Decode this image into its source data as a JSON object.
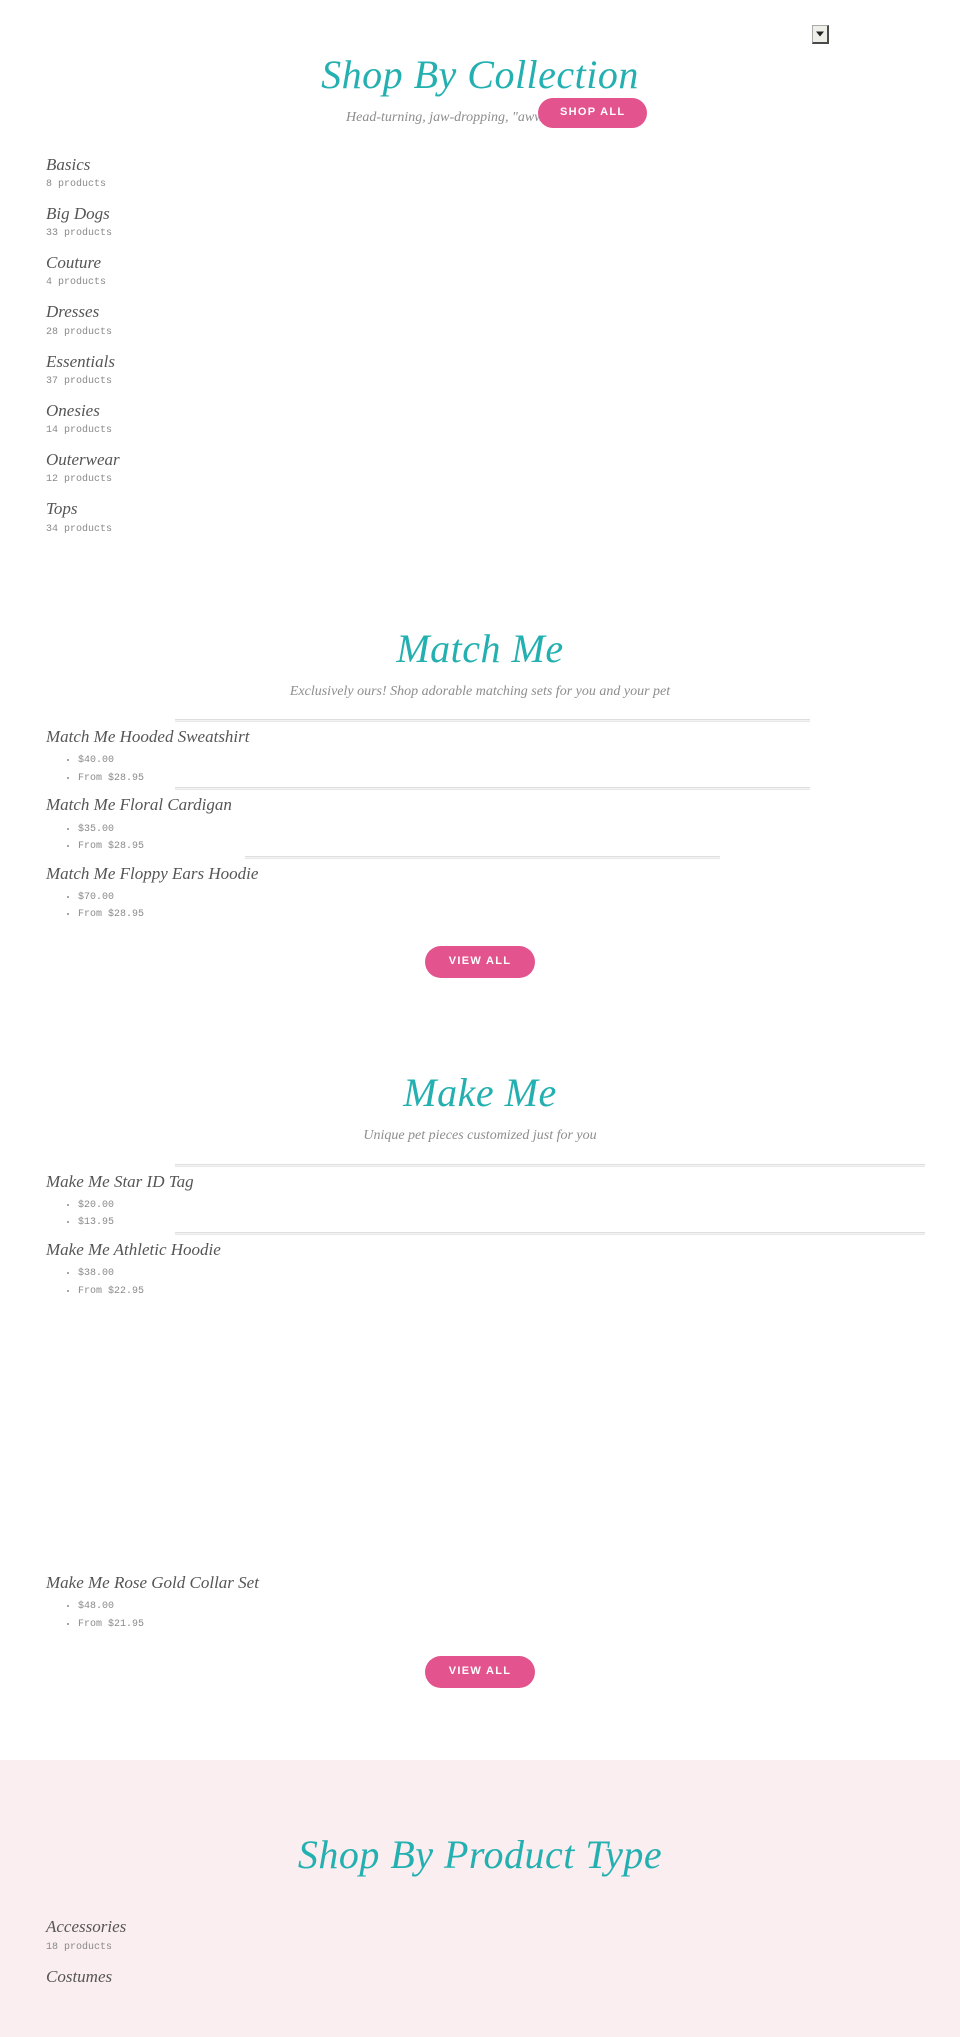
{
  "theme": {
    "accent_teal": "#24b0b0",
    "accent_pink": "#e3538e",
    "page_bg": "#ffffff",
    "section_bg_pink": "#faeef0",
    "text_gray": "#555555",
    "muted_gray": "#8a8a8a"
  },
  "top_control": {
    "name": "select-dropdown",
    "icon": "chevron-down-icon",
    "value": ""
  },
  "shop_by_collection": {
    "title": "Shop By Collection",
    "subtitle": "Head-turning, jaw-dropping, \"awww\"-inspiring",
    "button_label": "SHOP ALL",
    "collections": [
      {
        "name": "Basics",
        "count": "8 products"
      },
      {
        "name": "Big Dogs",
        "count": "33 products"
      },
      {
        "name": "Couture",
        "count": "4 products"
      },
      {
        "name": "Dresses",
        "count": "28 products"
      },
      {
        "name": "Essentials",
        "count": "37 products"
      },
      {
        "name": "Onesies",
        "count": "14 products"
      },
      {
        "name": "Outerwear",
        "count": "12 products"
      },
      {
        "name": "Tops",
        "count": "34 products"
      }
    ]
  },
  "match_me": {
    "title": "Match Me",
    "subtitle": "Exclusively ours! Shop adorable matching sets for you and your pet",
    "button_label": "VIEW ALL",
    "products": [
      {
        "title": "Match Me Hooded Sweatshirt",
        "prices": [
          "$40.00",
          "From $28.95"
        ]
      },
      {
        "title": "Match Me Floral Cardigan",
        "prices": [
          "$35.00",
          "From $28.95"
        ]
      },
      {
        "title": "Match Me Floppy Ears Hoodie",
        "prices": [
          "$70.00",
          "From $28.95"
        ]
      }
    ]
  },
  "make_me": {
    "title": "Make Me",
    "subtitle": "Unique pet pieces customized just for you",
    "button_label": "VIEW ALL",
    "products": [
      {
        "title": "Make Me Star ID Tag",
        "prices": [
          "$20.00",
          "$13.95"
        ]
      },
      {
        "title": "Make Me Athletic Hoodie",
        "prices": [
          "$38.00",
          "From $22.95"
        ]
      },
      {
        "title": "Make Me Rose Gold Collar Set",
        "prices": [
          "$48.00",
          "From $21.95"
        ]
      }
    ]
  },
  "shop_by_product_type": {
    "title": "Shop By Product Type",
    "collections": [
      {
        "name": "Accessories",
        "count": "18 products"
      },
      {
        "name": "Costumes",
        "count": ""
      }
    ]
  }
}
